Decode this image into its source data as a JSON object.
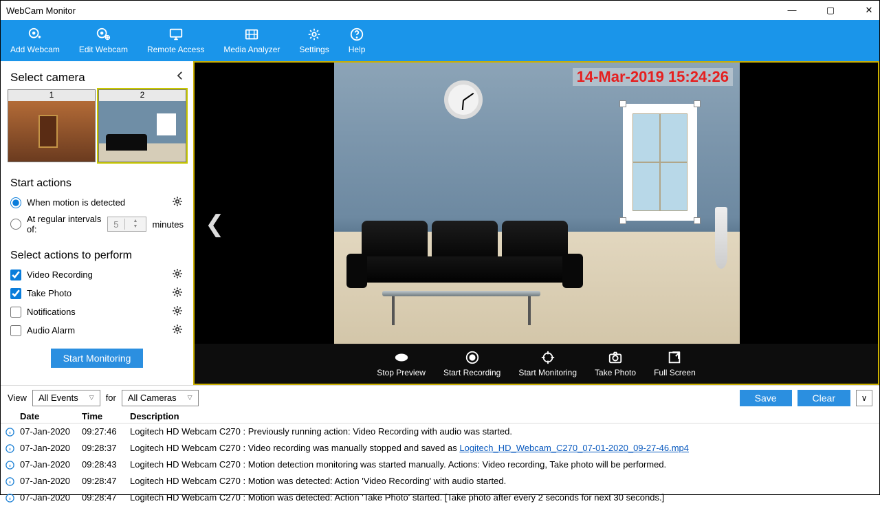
{
  "titlebar": {
    "title": "WebCam Monitor"
  },
  "toolbar": {
    "add_webcam": "Add Webcam",
    "edit_webcam": "Edit Webcam",
    "remote_access": "Remote Access",
    "media_analyzer": "Media Analyzer",
    "settings": "Settings",
    "help": "Help"
  },
  "sidebar": {
    "select_camera_label": "Select camera",
    "cams": [
      "1",
      "2"
    ],
    "start_actions_label": "Start actions",
    "option_motion": "When motion is detected",
    "option_interval_prefix": "At regular intervals of:",
    "interval_value": "5",
    "interval_unit": "minutes",
    "select_actions_label": "Select actions to perform",
    "actions": {
      "video": "Video Recording",
      "photo": "Take Photo",
      "notif": "Notifications",
      "audio": "Audio Alarm"
    },
    "start_monitoring_btn": "Start Monitoring"
  },
  "preview": {
    "timestamp": "14-Mar-2019 15:24:26",
    "ctrls": {
      "stop_preview": "Stop Preview",
      "start_recording": "Start Recording",
      "start_monitoring": "Start Monitoring",
      "take_photo": "Take Photo",
      "full_screen": "Full Screen"
    }
  },
  "log_filter": {
    "view_label": "View",
    "events_value": "All Events",
    "for_label": "for",
    "cameras_value": "All Cameras",
    "save": "Save",
    "clear": "Clear"
  },
  "log_cols": {
    "date": "Date",
    "time": "Time",
    "desc": "Description"
  },
  "log": [
    {
      "date": "07-Jan-2020",
      "time": "09:27:46",
      "desc": "Logitech HD Webcam C270 : Previously running action: Video Recording with audio was started."
    },
    {
      "date": "07-Jan-2020",
      "time": "09:28:37",
      "desc": "Logitech HD Webcam C270 : Video recording was manually stopped and saved as ",
      "link": "Logitech_HD_Webcam_C270_07-01-2020_09-27-46.mp4"
    },
    {
      "date": "07-Jan-2020",
      "time": "09:28:43",
      "desc": "Logitech HD Webcam C270 : Motion detection monitoring was started manually. Actions: Video recording, Take photo will be performed."
    },
    {
      "date": "07-Jan-2020",
      "time": "09:28:47",
      "desc": "Logitech HD Webcam C270 : Motion was detected: Action 'Video Recording' with audio started."
    },
    {
      "date": "07-Jan-2020",
      "time": "09:28:47",
      "desc": "Logitech HD Webcam C270 : Motion was detected: Action 'Take Photo' started. [Take photo after every 2 seconds for next 30 seconds.]"
    }
  ]
}
